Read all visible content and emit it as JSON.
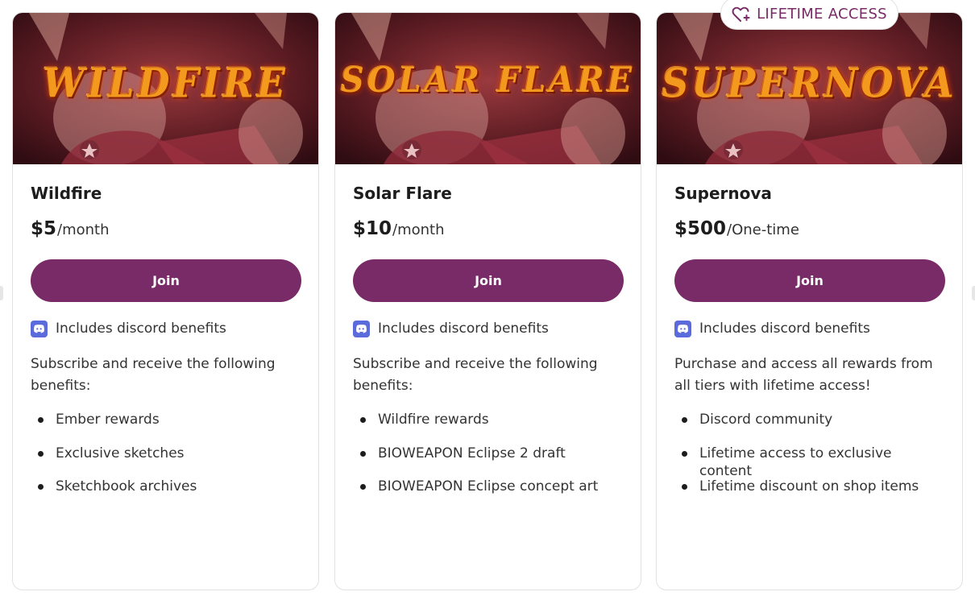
{
  "badge": {
    "label": "LIFETIME ACCESS",
    "icon": "heart-plus-icon",
    "color": "#782b66"
  },
  "colors": {
    "accent": "#782b66",
    "discord": "#5c6bdc"
  },
  "tiers": [
    {
      "banner_text": "WILDFIRE",
      "name": "Wildfire",
      "price": "$5",
      "period": "/month",
      "join_label": "Join",
      "discord_label": "Includes discord benefits",
      "description": "Subscribe and receive the following benefits:",
      "benefits": [
        "Ember rewards",
        "Exclusive sketches",
        "Sketchbook archives"
      ]
    },
    {
      "banner_text": "SOLAR FLARE",
      "name": "Solar Flare",
      "price": "$10",
      "period": "/month",
      "join_label": "Join",
      "discord_label": "Includes discord benefits",
      "description": "Subscribe and receive the following benefits:",
      "benefits": [
        "Wildfire rewards",
        "BIOWEAPON Eclipse 2 draft",
        "BIOWEAPON Eclipse concept art"
      ]
    },
    {
      "banner_text": "SUPERNOVA",
      "name": "Supernova",
      "price": "$500",
      "period": "/One-time",
      "join_label": "Join",
      "discord_label": "Includes discord benefits",
      "description": "Purchase and access all rewards from all tiers with lifetime access!",
      "benefits": [
        "Discord community",
        "Lifetime access to exclusive content",
        "Lifetime discount on shop items"
      ]
    }
  ]
}
